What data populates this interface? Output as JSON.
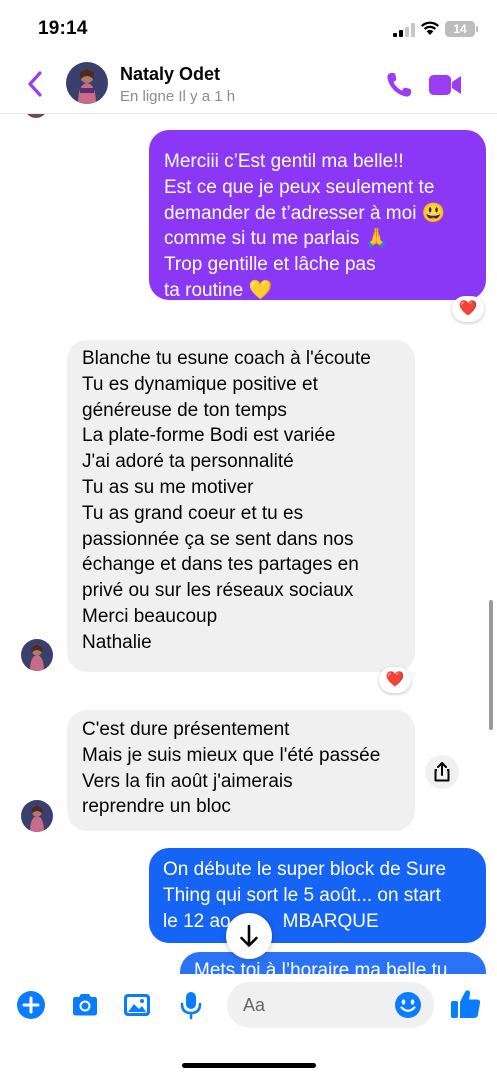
{
  "status_bar": {
    "time": "19:14",
    "battery": "14"
  },
  "header": {
    "contact_name": "Nataly Odet",
    "contact_status": "En ligne Il y a 1 h",
    "back_icon": "chevron-left-icon",
    "call_icon": "phone-icon",
    "video_icon": "video-camera-icon"
  },
  "messages": [
    {
      "id": "msg1",
      "sender": "me",
      "lines": [
        "Merciii c’Est gentil ma belle!!",
        "Est ce que je peux seulement te",
        "demander de t’adresser à moi 😃",
        "comme si tu me parlais 🙏",
        "Trop gentille et lâche pas",
        "ta routine 💛"
      ],
      "reaction": "❤️"
    },
    {
      "id": "msg2",
      "sender": "contact",
      "lines": [
        "Blanche tu esune coach à l'écoute",
        "Tu es dynamique positive et",
        "généreuse de ton temps",
        "La plate-forme Bodi est variée",
        "J'ai adoré ta personnalité",
        "Tu as su me motiver",
        "Tu as grand coeur et tu es",
        "passionnée ça se sent dans nos",
        "échange et dans tes partages en",
        "privé ou sur les réseaux sociaux",
        "Merci beaucoup",
        "Nathalie"
      ],
      "reaction": "❤️"
    },
    {
      "id": "msg3",
      "sender": "contact",
      "lines": [
        "C'est dure présentement",
        "Mais je suis mieux que l'été passée",
        "Vers la fin août j'aimerais",
        "reprendre un bloc"
      ]
    },
    {
      "id": "msg4",
      "sender": "me",
      "lines": [
        "On débute le super block de Sure",
        "Thing qui sort le 5 août... on start",
        "le 12 ao",
        "MBARQUE"
      ]
    },
    {
      "id": "msg5",
      "sender": "me",
      "lines": [
        "Mets toi à l’horaire ma belle tu"
      ]
    }
  ],
  "composer": {
    "placeholder": "Aa",
    "icons": [
      "plus-icon",
      "camera-icon",
      "photo-icon",
      "microphone-icon",
      "emoji-icon",
      "thumbs-up-icon"
    ]
  },
  "colors": {
    "purple_bubble": "#8a38f5",
    "blue_bubble": "#1664f5",
    "accent_purple": "#9b3df5",
    "accent_blue": "#0a7cff",
    "received_bubble": "#f0f0f0"
  }
}
